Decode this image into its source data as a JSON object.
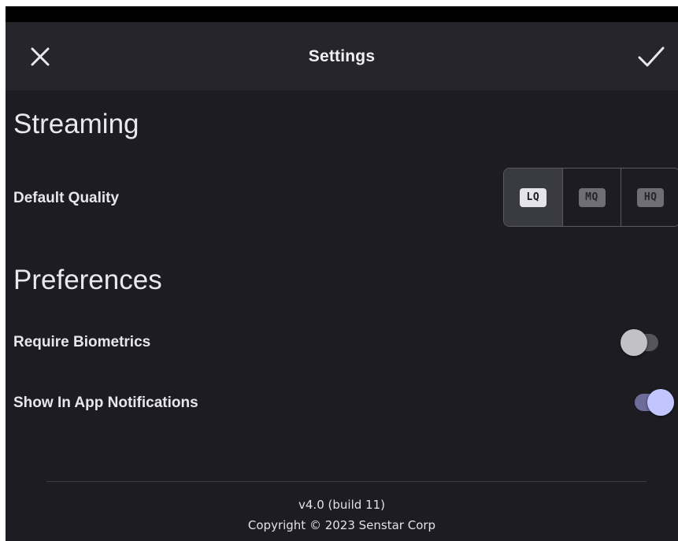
{
  "header": {
    "title": "Settings",
    "close_icon": "close-icon",
    "confirm_icon": "check-icon"
  },
  "streaming": {
    "section_title": "Streaming",
    "default_quality_label": "Default Quality",
    "quality_options": [
      {
        "label": "LQ",
        "selected": true
      },
      {
        "label": "MQ",
        "selected": false
      },
      {
        "label": "HQ",
        "selected": false
      }
    ]
  },
  "preferences": {
    "section_title": "Preferences",
    "require_biometrics": {
      "label": "Require Biometrics",
      "enabled": false
    },
    "show_in_app_notifications": {
      "label": "Show In App Notifications",
      "enabled": true
    }
  },
  "footer": {
    "version": "v4.0 (build 11)",
    "copyright": "Copyright © 2023 Senstar Corp"
  },
  "colors": {
    "background": "#1d1c22",
    "appbar": "#25252b",
    "toggle_on_thumb": "#c2c6ff",
    "toggle_on_track": "#6c6d99"
  }
}
